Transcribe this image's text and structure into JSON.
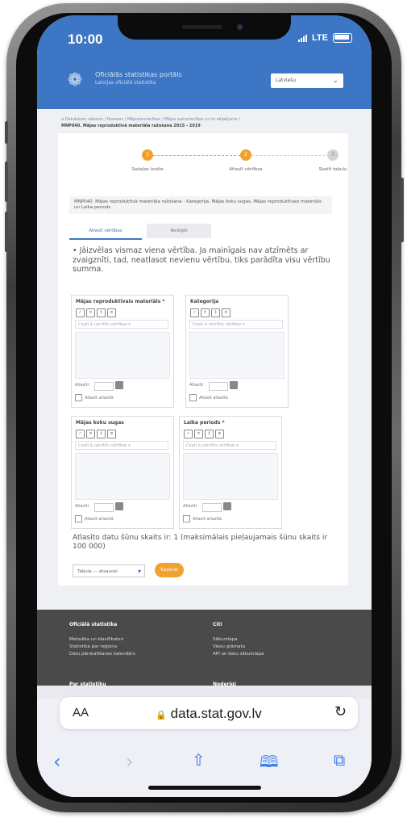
{
  "status_bar": {
    "time": "10:00",
    "network": "LTE"
  },
  "site": {
    "title": "Oficiālās statistikas portāls",
    "subtitle": "Latvijas oficiālā statistika",
    "language_select": "Latviešu"
  },
  "breadcrumb": {
    "path": "Datubāzes sākums / Nozares / Mājsaimniecības / Mājas saimniecības un to ekipējums /",
    "dataset": "MNP040. Mājas reproduktīvā materiāla ražošana 2015 - 2019"
  },
  "steps": [
    {
      "number": "1",
      "label": "Sadaļas izvēle"
    },
    {
      "number": "2",
      "label": "Atlasīt vērtības"
    },
    {
      "number": "3",
      "label": "Skatīt tabulu"
    }
  ],
  "dataset_info": "MNP040. Mājas reproduktīvā materiāla ražošana - Kategorija, Mājas koku sugas, Mājas reproduktīvais materiāls un Laika periods",
  "tabs": {
    "select_values": "Atlasīt vērtības",
    "edit": "Rediģēt"
  },
  "instruction": "• Jāizvēlas vismaz viena vērtība. Ja mainīgais nav atzīmēts ar zvaigznīti, tad, neatlasot nevienu vērtību, tiks parādīta visu vērtību summa.",
  "dimensions": [
    {
      "title": "Mājas reproduktīvais materiāls  *",
      "search": "Cepti & iekritīts vērtības  ▾",
      "footer": "Atlasīti",
      "check": "Atlasīt atlasītā"
    },
    {
      "title": "Kategorija",
      "search": "Cepti & iekritīts vērtības  ▾",
      "footer": "Atlasīti",
      "check": "Atlasīt atlasītā"
    },
    {
      "title": "Mājas koku sugas",
      "search": "Cepti & iekritīts vērtības  ▾",
      "footer": "Atlasīti",
      "check": "Atlasīt atlasītā"
    },
    {
      "title": "Laika periods  *",
      "search": "Cepti & iekritīts vērtības  ▾",
      "footer": "Atlasīti",
      "check": "Atlasīt atlasītā"
    }
  ],
  "cells_info": "Atlasīto datu šūnu skaits ir: 1  (maksimālais pieļaujamais šūnu skaits ir 100 000)",
  "download": {
    "format": "Tabula  —  atsaucei",
    "button": "Turpināt"
  },
  "footer": {
    "col1": {
      "heading": "Oficiālā statistika",
      "links": [
        "Metodika un klasifikatori",
        "Statistika par reģiona",
        "Datu pārskatīšanas kalendārs"
      ]
    },
    "col2": {
      "heading": "Citi",
      "links": [
        "Sākumlapa",
        "Viesu grāmata",
        "API un datu sākumlapa"
      ]
    },
    "col3": {
      "heading": "Par statistiku"
    },
    "col4": {
      "heading": "Noderīgi"
    }
  },
  "browser": {
    "aa": "AA",
    "url": "data.stat.gov.lv"
  },
  "colors": {
    "brand_blue": "#3d76c4",
    "accent_orange": "#f0a130",
    "footer_grey": "#4a4a4a",
    "ios_blue": "#3a7bf0"
  }
}
